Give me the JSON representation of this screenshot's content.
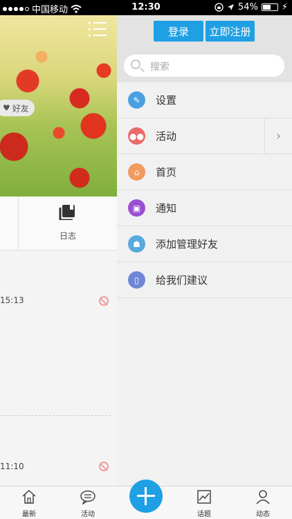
{
  "status_bar": {
    "carrier": "中国移动",
    "time": "12:30",
    "battery": "54%",
    "battery_level": 0.54
  },
  "left_panel": {
    "friend_chip": "好友",
    "log_tab_label": "日志",
    "feed_times": [
      "15:13",
      "11:10"
    ]
  },
  "drawer": {
    "login_button": "登录",
    "register_button": "立即注册",
    "search_placeholder": "搜索",
    "menu": [
      {
        "label": "设置",
        "icon": "edit-icon",
        "color": "#4aa0df"
      },
      {
        "label": "活动",
        "icon": "group-icon",
        "color": "#ea6a6a"
      },
      {
        "label": "首页",
        "icon": "home-icon",
        "color": "#f39a5f"
      },
      {
        "label": "通知",
        "icon": "notice-icon",
        "color": "#9b4fd1"
      },
      {
        "label": "添加管理好友",
        "icon": "friends-icon",
        "color": "#58a9de"
      },
      {
        "label": "给我们建议",
        "icon": "phone-icon",
        "color": "#6e86d6"
      }
    ]
  },
  "tab_bar": {
    "items": [
      {
        "label": "最新",
        "icon": "home-outline-icon"
      },
      {
        "label": "活动",
        "icon": "chat-bubble-icon"
      },
      {
        "label": "话题",
        "icon": "chart-icon"
      },
      {
        "label": "动态",
        "icon": "person-icon"
      }
    ]
  }
}
